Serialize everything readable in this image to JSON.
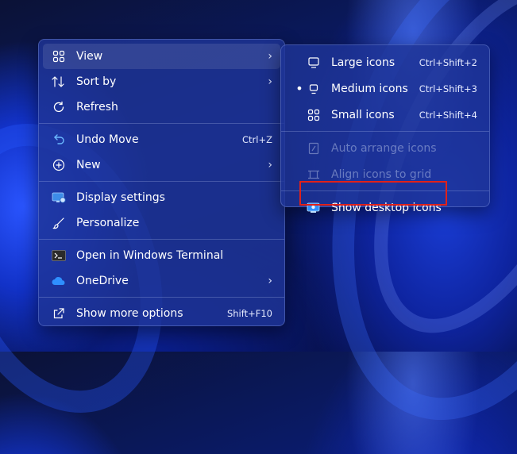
{
  "context_menu": {
    "items": [
      {
        "label": "View",
        "icon": "grid-icon",
        "has_submenu": true
      },
      {
        "label": "Sort by",
        "icon": "sort-icon",
        "has_submenu": true
      },
      {
        "label": "Refresh",
        "icon": "refresh-icon"
      },
      {
        "label": "Undo Move",
        "icon": "undo-icon",
        "shortcut": "Ctrl+Z"
      },
      {
        "label": "New",
        "icon": "add-circle-icon",
        "has_submenu": true
      },
      {
        "label": "Display settings",
        "icon": "display-icon"
      },
      {
        "label": "Personalize",
        "icon": "brush-icon"
      },
      {
        "label": "Open in Windows Terminal",
        "icon": "terminal-icon"
      },
      {
        "label": "OneDrive",
        "icon": "cloud-icon",
        "has_submenu": true
      },
      {
        "label": "Show more options",
        "icon": "share-icon",
        "shortcut": "Shift+F10"
      }
    ]
  },
  "view_submenu": {
    "items": [
      {
        "label": "Large icons",
        "shortcut": "Ctrl+Shift+2"
      },
      {
        "label": "Medium icons",
        "shortcut": "Ctrl+Shift+3",
        "selected": true
      },
      {
        "label": "Small icons",
        "shortcut": "Ctrl+Shift+4"
      },
      {
        "label": "Auto arrange icons",
        "disabled": true
      },
      {
        "label": "Align icons to grid",
        "disabled": true
      },
      {
        "label": "Show desktop icons",
        "highlighted": true
      }
    ]
  },
  "colors": {
    "menu_bg": "#1e3496",
    "highlight_border": "#e0211a",
    "accent": "#4aa3ff"
  }
}
